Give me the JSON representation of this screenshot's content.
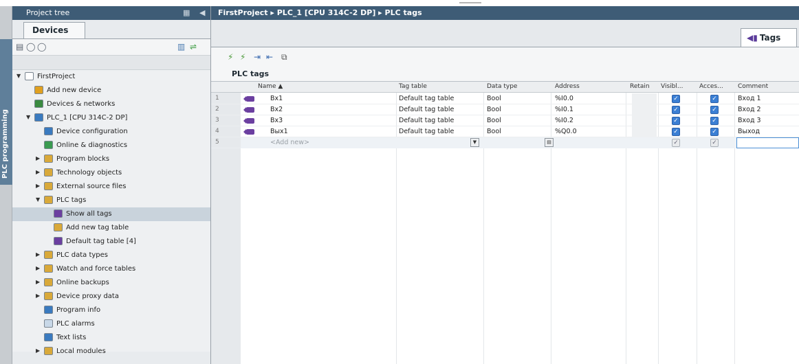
{
  "side_tab": {
    "label": "PLC programming"
  },
  "project_tree": {
    "title": "Project tree",
    "devices_tab": "Devices",
    "items": [
      {
        "label": "FirstProject",
        "level": 0,
        "expander": "down",
        "icon": "project-icon"
      },
      {
        "label": "Add new device",
        "level": 1,
        "expander": "none",
        "icon": "add-device-icon"
      },
      {
        "label": "Devices & networks",
        "level": 1,
        "expander": "none",
        "icon": "network-icon"
      },
      {
        "label": "PLC_1 [CPU 314C-2 DP]",
        "level": 1,
        "expander": "down",
        "icon": "plc-icon"
      },
      {
        "label": "Device configuration",
        "level": 2,
        "expander": "none",
        "icon": "device-config-icon"
      },
      {
        "label": "Online & diagnostics",
        "level": 2,
        "expander": "none",
        "icon": "diagnostics-icon"
      },
      {
        "label": "Program blocks",
        "level": 2,
        "expander": "right",
        "icon": "folder-icon"
      },
      {
        "label": "Technology objects",
        "level": 2,
        "expander": "right",
        "icon": "folder-icon"
      },
      {
        "label": "External source files",
        "level": 2,
        "expander": "right",
        "icon": "folder-icon"
      },
      {
        "label": "PLC tags",
        "level": 2,
        "expander": "down",
        "icon": "folder-icon"
      },
      {
        "label": "Show all tags",
        "level": 3,
        "expander": "none",
        "icon": "tags-icon",
        "selected": true
      },
      {
        "label": "Add new tag table",
        "level": 3,
        "expander": "none",
        "icon": "add-table-icon"
      },
      {
        "label": "Default tag table [4]",
        "level": 3,
        "expander": "none",
        "icon": "tag-table-icon"
      },
      {
        "label": "PLC data types",
        "level": 2,
        "expander": "right",
        "icon": "folder-icon"
      },
      {
        "label": "Watch and force tables",
        "level": 2,
        "expander": "right",
        "icon": "folder-icon"
      },
      {
        "label": "Online backups",
        "level": 2,
        "expander": "right",
        "icon": "folder-icon"
      },
      {
        "label": "Device proxy data",
        "level": 2,
        "expander": "right",
        "icon": "folder-icon"
      },
      {
        "label": "Program info",
        "level": 2,
        "expander": "none",
        "icon": "info-icon"
      },
      {
        "label": "PLC alarms",
        "level": 2,
        "expander": "none",
        "icon": "alarm-icon"
      },
      {
        "label": "Text lists",
        "level": 2,
        "expander": "none",
        "icon": "text-list-icon"
      },
      {
        "label": "Local modules",
        "level": 2,
        "expander": "right",
        "icon": "folder-icon"
      }
    ]
  },
  "breadcrumb": "FirstProject ▸ PLC_1 [CPU 314C-2 DP] ▸ PLC tags",
  "editor": {
    "tab_label": "Tags",
    "table_caption": "PLC tags",
    "columns": {
      "name": "Name ▲",
      "tag_table": "Tag table",
      "data_type": "Data type",
      "address": "Address",
      "retain": "Retain",
      "visible": "Visibl...",
      "access": "Acces...",
      "comment": "Comment"
    },
    "rows": [
      {
        "num": "1",
        "name": "Bx1",
        "tag_table": "Default tag table",
        "data_type": "Bool",
        "address": "%I0.0",
        "visible": true,
        "access": true,
        "comment": "Вход 1"
      },
      {
        "num": "2",
        "name": "Bx2",
        "tag_table": "Default tag table",
        "data_type": "Bool",
        "address": "%I0.1",
        "visible": true,
        "access": true,
        "comment": "Вход 2"
      },
      {
        "num": "3",
        "name": "Bx3",
        "tag_table": "Default tag table",
        "data_type": "Bool",
        "address": "%I0.2",
        "visible": true,
        "access": true,
        "comment": "Вход 3"
      },
      {
        "num": "4",
        "name": "Вых1",
        "tag_table": "Default tag table",
        "data_type": "Bool",
        "address": "%Q0.0",
        "visible": true,
        "access": true,
        "comment": "Выход"
      }
    ],
    "new_row": {
      "num": "5",
      "name_placeholder": "<Add new>"
    }
  },
  "colors": {
    "title_bar": "#3e5c76",
    "accent_checkbox": "#3b7fd4",
    "tag_icon": "#6b3fa0",
    "selection": "#c9d3dc"
  }
}
